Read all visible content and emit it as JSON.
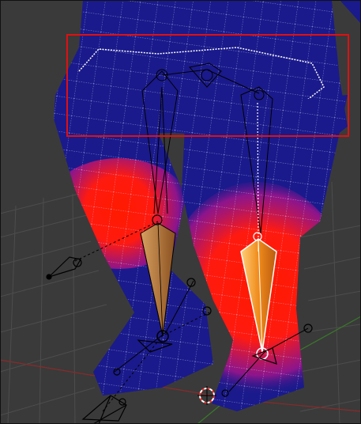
{
  "viewport": {
    "mode": "weight-paint",
    "background_color": "#3a3a3a",
    "grid_color": "#4a4a4a",
    "mesh_zero_weight_color": "#1a1a8c",
    "mesh_full_weight_color": "#ff1a00",
    "wire_color": "#d8d8ff",
    "selection_box_color": "#e01010",
    "active_bone_color": "#f08a1a",
    "inactive_bone_color": "#c8803a",
    "x_axis_color": "#8a2a2a",
    "y_axis_color": "#3a7a2a"
  },
  "objects": [
    {
      "name": "mesh-character-legs",
      "icon": "mesh"
    },
    {
      "name": "armature-bone-left-shin",
      "icon": "bone",
      "selected": false
    },
    {
      "name": "armature-bone-right-shin",
      "icon": "bone",
      "selected": true
    },
    {
      "name": "ik-target-left",
      "icon": "empty-target"
    },
    {
      "name": "ik-target-right",
      "icon": "empty-target"
    },
    {
      "name": "3d-cursor",
      "icon": "cursor"
    },
    {
      "name": "camera",
      "icon": "camera"
    }
  ]
}
